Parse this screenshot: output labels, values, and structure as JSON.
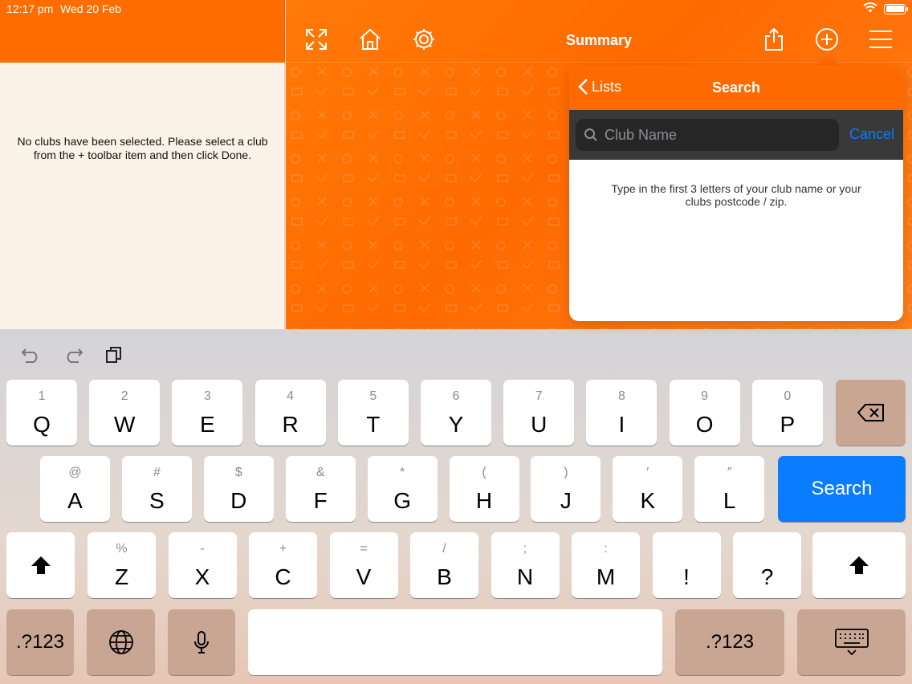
{
  "status_bar": {
    "time": "12:17 pm",
    "date": "Wed 20 Feb",
    "wifi_icon": "wifi-icon",
    "battery_icon": "battery-icon"
  },
  "left_pane": {
    "message": "No clubs have been selected. Please select a club from the + toolbar item and then click Done."
  },
  "toolbar": {
    "title": "Summary",
    "icons": [
      "expand-icon",
      "home-icon",
      "gear-icon",
      "share-icon",
      "add-icon",
      "menu-icon"
    ]
  },
  "popover": {
    "back_label": "Lists",
    "title": "Search",
    "search_placeholder": "Club Name",
    "cancel_label": "Cancel",
    "help_text": "Type in the first 3 letters of your club name or your clubs postcode / zip."
  },
  "keyboard": {
    "tools": [
      "undo-icon",
      "redo-icon",
      "paste-icon"
    ],
    "row1": [
      {
        "sub": "1",
        "main": "Q"
      },
      {
        "sub": "2",
        "main": "W"
      },
      {
        "sub": "3",
        "main": "E"
      },
      {
        "sub": "4",
        "main": "R"
      },
      {
        "sub": "5",
        "main": "T"
      },
      {
        "sub": "6",
        "main": "Y"
      },
      {
        "sub": "7",
        "main": "U"
      },
      {
        "sub": "8",
        "main": "I"
      },
      {
        "sub": "9",
        "main": "O"
      },
      {
        "sub": "0",
        "main": "P"
      }
    ],
    "row2": [
      {
        "sub": "@",
        "main": "A"
      },
      {
        "sub": "#",
        "main": "S"
      },
      {
        "sub": "$",
        "main": "D"
      },
      {
        "sub": "&",
        "main": "F"
      },
      {
        "sub": "*",
        "main": "G"
      },
      {
        "sub": "(",
        "main": "H"
      },
      {
        "sub": ")",
        "main": "J"
      },
      {
        "sub": "′",
        "main": "K"
      },
      {
        "sub": "″",
        "main": "L"
      }
    ],
    "row3": [
      {
        "sub": "%",
        "main": "Z"
      },
      {
        "sub": "-",
        "main": "X"
      },
      {
        "sub": "+",
        "main": "C"
      },
      {
        "sub": "=",
        "main": "V"
      },
      {
        "sub": "/",
        "main": "B"
      },
      {
        "sub": ";",
        "main": "N"
      },
      {
        "sub": ":",
        "main": "M"
      },
      {
        "sub": "",
        "main": "!"
      },
      {
        "sub": "",
        "main": "?"
      }
    ],
    "search_key": "Search",
    "numbers_key": ".?123",
    "numbers_key_right": ".?123"
  }
}
